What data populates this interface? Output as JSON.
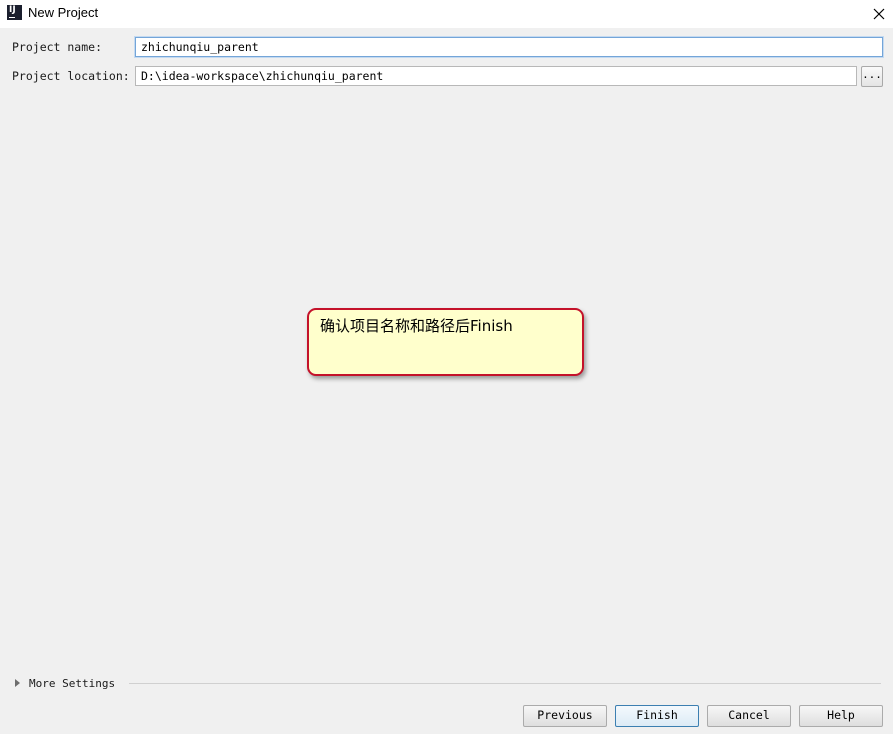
{
  "window": {
    "title": "New Project",
    "icon_text": "IJ"
  },
  "form": {
    "name_label": "Project name:",
    "name_value": "zhichunqiu_parent",
    "location_label": "Project location:",
    "location_value": "D:\\idea-workspace\\zhichunqiu_parent",
    "browse_label": "..."
  },
  "annotation": {
    "text": "确认项目名称和路径后Finish"
  },
  "more_settings": {
    "label": "More Settings"
  },
  "buttons": {
    "previous": "Previous",
    "finish": "Finish",
    "cancel": "Cancel",
    "help": "Help"
  },
  "colors": {
    "callout_border": "#c4122a",
    "callout_fill": "#ffffcc",
    "focus_border": "#74a5d8"
  },
  "icons": [
    "app-icon",
    "close-icon",
    "expand-triangle-icon"
  ]
}
